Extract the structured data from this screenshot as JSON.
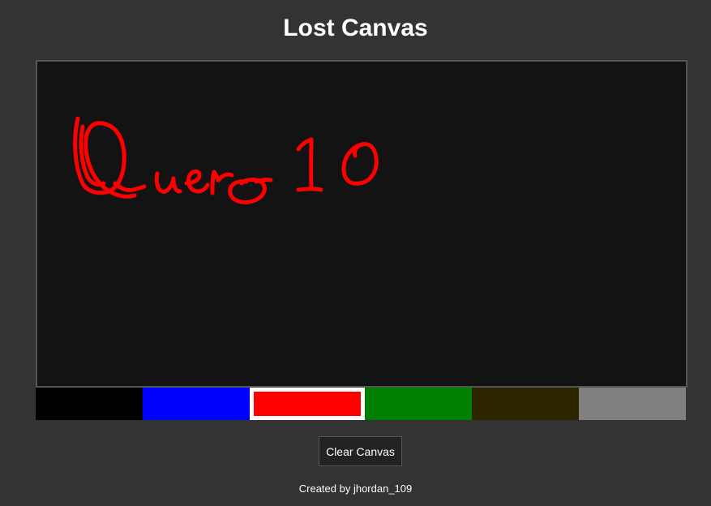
{
  "page": {
    "title": "Lost Canvas",
    "background_color": "#333333",
    "canvas_background": "#131313"
  },
  "canvas": {
    "drawing_text": "Quero 10",
    "stroke_color": "#ff0000"
  },
  "palette": {
    "selected_index": 2,
    "swatches": [
      {
        "name": "black",
        "color": "#000000"
      },
      {
        "name": "blue",
        "color": "#0000ff"
      },
      {
        "name": "red",
        "color": "#ff0000"
      },
      {
        "name": "green",
        "color": "#008000"
      },
      {
        "name": "dark-brown",
        "color": "#2d2400"
      },
      {
        "name": "gray",
        "color": "#808080"
      }
    ]
  },
  "controls": {
    "clear_label": "Clear Canvas"
  },
  "footer": {
    "credit": "Created by jhordan_109"
  }
}
